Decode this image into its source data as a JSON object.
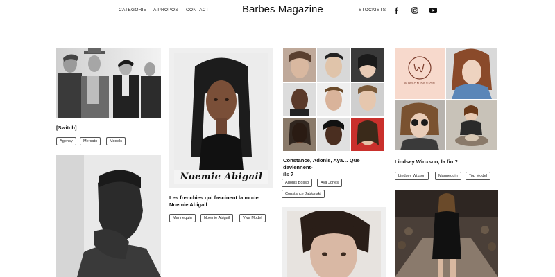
{
  "header": {
    "brand": "Barbes Magazine",
    "nav": [
      "CATEGORIE",
      "A PROPOS",
      "CONTACT"
    ],
    "stockists": "STOCKISTS",
    "social": [
      "facebook-icon",
      "instagram-icon",
      "youtube-icon"
    ]
  },
  "articles": [
    {
      "title": "[Switch]",
      "tags": [
        "Agency",
        "Mercato",
        "Models"
      ]
    },
    {
      "title": "Les frenchies qui fascinent la mode : Noemie Abigail",
      "title_line1": "Les frenchies qui fascinent la mode :",
      "title_line2": "Noemie Abigail",
      "tags": [
        "Mannequin",
        "Noemie Abigail",
        "Viva Model"
      ],
      "photo_caption": "Noemie Abigail"
    },
    {
      "title": "Constance, Adonis, Aya… Que deviennent-ils ?",
      "title_line1": "Constance, Adonis, Aya… Que deviennent-",
      "title_line2": "ils ?",
      "tags": [
        "Adonis Bosso",
        "Aya Jones",
        "Constance Jablonski"
      ]
    },
    {
      "title": "Lindsey Winxson, la fin ?",
      "tags": [
        "Lindsey Wixson",
        "Mannequin",
        "Top Model"
      ],
      "logo_text": "WIXSON DESIGN"
    }
  ],
  "colors": {
    "text": "#111111",
    "border": "#555555",
    "frame": "#efefef"
  }
}
